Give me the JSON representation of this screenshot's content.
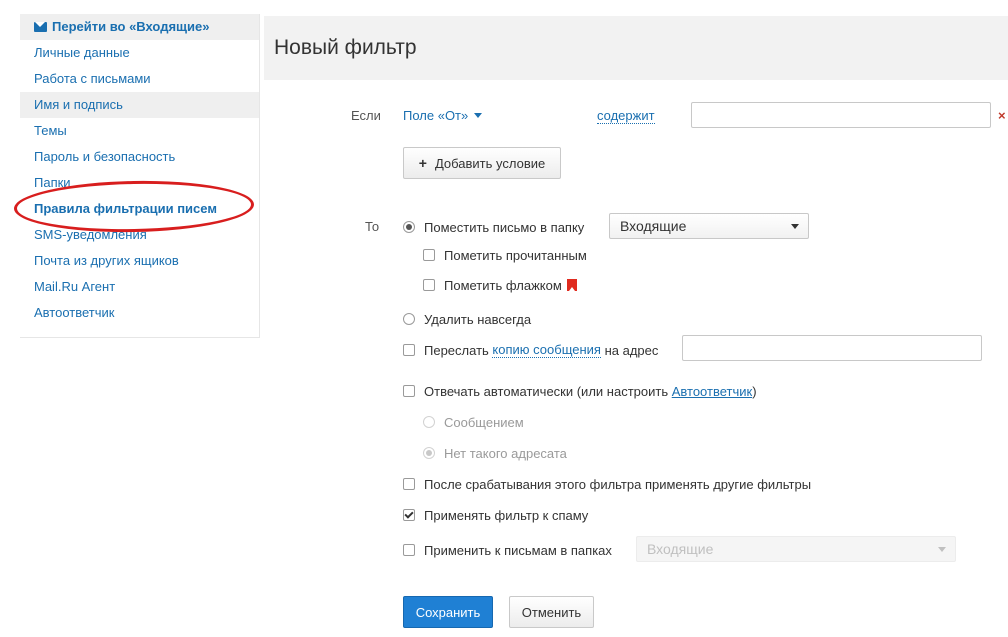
{
  "sidebar": {
    "inbox_link": "Перейти во «Входящие»",
    "items": [
      {
        "label": "Личные данные"
      },
      {
        "label": "Работа с письмами"
      },
      {
        "label": "Имя и подпись"
      },
      {
        "label": "Темы"
      },
      {
        "label": "Пароль и безопасность"
      },
      {
        "label": "Папки"
      },
      {
        "label": "Правила фильтрации писем"
      },
      {
        "label": "SMS-уведомления"
      },
      {
        "label": "Почта из других ящиков"
      },
      {
        "label": "Mail.Ru Агент"
      },
      {
        "label": "Автоответчик"
      }
    ],
    "highlight_color": "#d81e1e"
  },
  "header": {
    "title": "Новый фильтр"
  },
  "condition": {
    "if_label": "Если",
    "field_dropdown": "Поле «От»",
    "operator_link": "содержит",
    "value": "",
    "remove_symbol": "×",
    "add_condition_button": "Добавить условие"
  },
  "actions": {
    "then_label": "То",
    "move_to_folder": {
      "label": "Поместить письмо в папку",
      "selected": true,
      "folder": "Входящие"
    },
    "mark_read": {
      "label": "Пометить прочитанным",
      "checked": false
    },
    "mark_flag": {
      "label": "Пометить флажком",
      "checked": false
    },
    "delete_forever": {
      "label": "Удалить навсегда",
      "selected": false
    },
    "forward": {
      "label_before": "Переслать",
      "link": "копию сообщения",
      "label_after": "на адрес",
      "checked": false,
      "value": ""
    },
    "auto_reply": {
      "label_before": "Отвечать автоматически (или настроить",
      "link": "Автоответчик",
      "label_after": ")",
      "checked": false
    },
    "reply_message": {
      "label": "Сообщением",
      "selected": false
    },
    "reply_no_such": {
      "label": "Нет такого адресата",
      "selected": true
    },
    "apply_other_filters": {
      "label": "После срабатывания этого фильтра применять другие фильтры",
      "checked": false
    },
    "apply_to_spam": {
      "label": "Применять фильтр к спаму",
      "checked": true
    },
    "apply_in_folders": {
      "label": "Применить к письмам в папках",
      "checked": false,
      "folder": "Входящие"
    }
  },
  "footer": {
    "save_button": "Сохранить",
    "cancel_button": "Отменить"
  },
  "colors": {
    "link": "#1a6fb0",
    "primary_button": "#1f80d4",
    "flag": "#e02b1f"
  }
}
